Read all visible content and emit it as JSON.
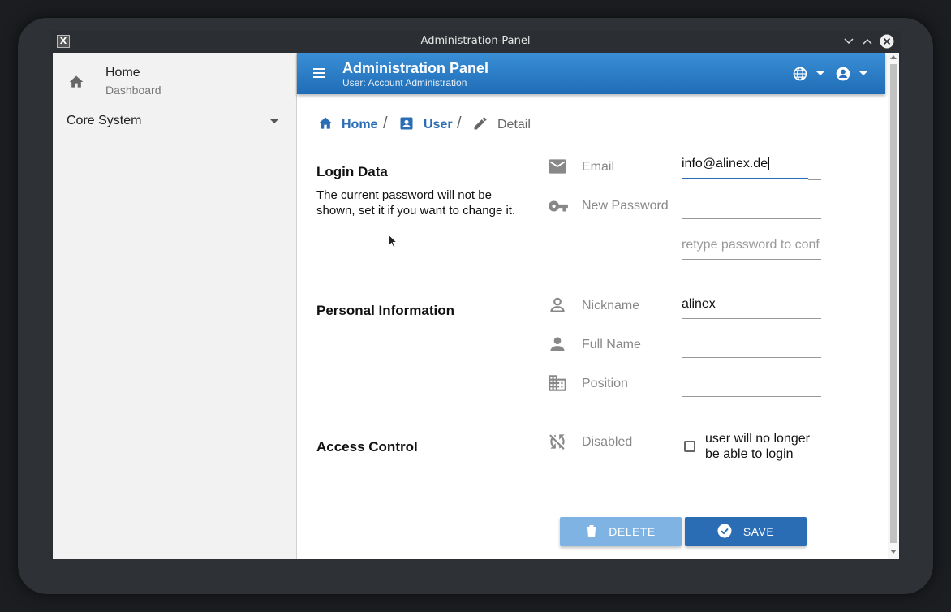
{
  "window": {
    "title": "Administration-Panel"
  },
  "sidebar": {
    "home": {
      "title": "Home",
      "subtitle": "Dashboard"
    },
    "core": {
      "label": "Core System"
    }
  },
  "appbar": {
    "title": "Administration Panel",
    "subtitle": "User: Account Administration"
  },
  "breadcrumb": [
    {
      "label": "Home",
      "icon": "home-icon"
    },
    {
      "label": "User",
      "icon": "account-box-icon"
    },
    {
      "label": "Detail",
      "icon": "pencil-icon"
    }
  ],
  "sections": {
    "login": {
      "title": "Login Data",
      "desc_line1": "The current password will not be",
      "desc_line2": "shown, set it if you want to change it."
    },
    "personal": {
      "title": "Personal Information"
    },
    "access": {
      "title": "Access Control"
    }
  },
  "fields": {
    "email": {
      "label": "Email",
      "value": "info@alinex.de"
    },
    "password": {
      "label": "New Password",
      "value": "",
      "confirm_placeholder": "retype password to conf"
    },
    "nickname": {
      "label": "Nickname",
      "value": "alinex"
    },
    "fullname": {
      "label": "Full Name",
      "value": ""
    },
    "position": {
      "label": "Position",
      "value": ""
    },
    "disabled": {
      "label": "Disabled",
      "checked": false,
      "check_line1": "user will no longer",
      "check_line2": "be able to login"
    }
  },
  "buttons": {
    "delete": "DELETE",
    "save": "SAVE"
  },
  "colors": {
    "primary": "#2a6db4",
    "appbar_top": "#3a8fd6",
    "delete_bg": "#7fb3e4"
  }
}
